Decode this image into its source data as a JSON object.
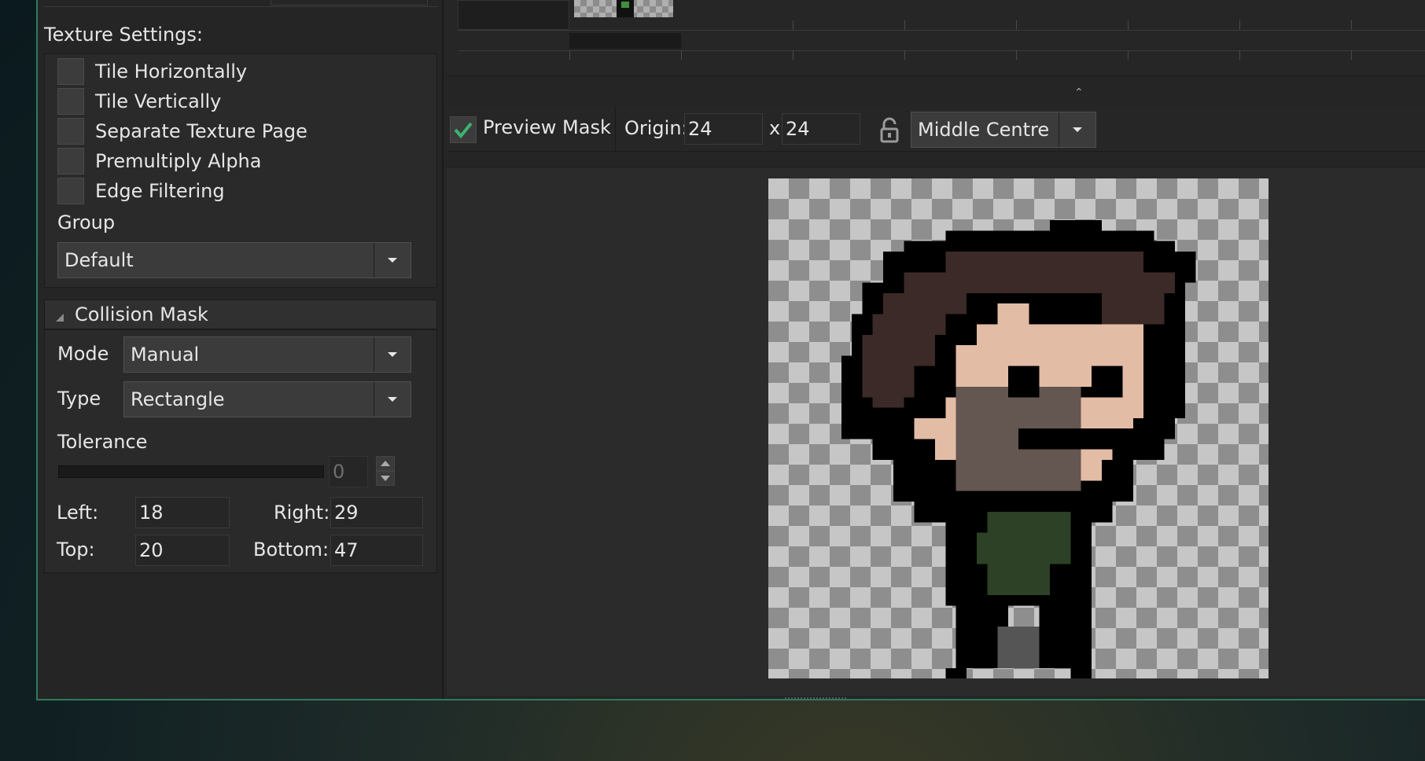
{
  "texture_settings": {
    "title": "Texture Settings:",
    "options": [
      {
        "label": "Tile Horizontally",
        "checked": false
      },
      {
        "label": "Tile Vertically",
        "checked": false
      },
      {
        "label": "Separate Texture Page",
        "checked": false
      },
      {
        "label": "Premultiply Alpha",
        "checked": false
      },
      {
        "label": "Edge Filtering",
        "checked": false
      }
    ],
    "group_label": "Group",
    "group_value": "Default"
  },
  "collision_mask": {
    "title": "Collision Mask",
    "mode_label": "Mode",
    "mode_value": "Manual",
    "type_label": "Type",
    "type_value": "Rectangle",
    "tolerance_label": "Tolerance",
    "tolerance_value": "0",
    "left_label": "Left:",
    "left_value": "18",
    "right_label": "Right:",
    "right_value": "29",
    "top_label": "Top:",
    "top_value": "20",
    "bottom_label": "Bottom:",
    "bottom_value": "47"
  },
  "toolbar": {
    "preview_mask_label": "Preview Mask",
    "preview_mask_checked": true,
    "origin_label": "Origin:",
    "origin_x": "24",
    "origin_sep": "x",
    "origin_y": "24",
    "origin_preset": "Middle Centre"
  },
  "colors": {
    "accent_check": "#3cb371",
    "window_border": "#2f7a5e"
  }
}
